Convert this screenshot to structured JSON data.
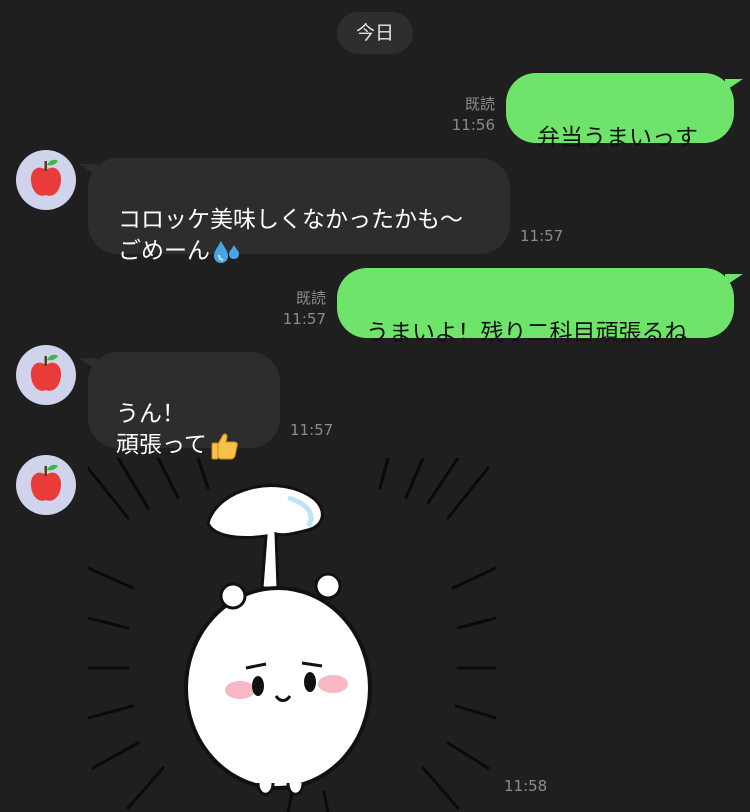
{
  "date_divider": "今日",
  "messages": [
    {
      "side": "out",
      "text": "弁当うまいっす",
      "read": "既読",
      "time": "11:56"
    },
    {
      "side": "in",
      "text": "コロッケ美味しくなかったかも〜\nごめーん",
      "emoji": "sweat-droplets-icon",
      "time": "11:57"
    },
    {
      "side": "out",
      "text": "うまいよ！残り二科目頑張るね",
      "read": "既読",
      "time": "11:57"
    },
    {
      "side": "in",
      "text": "うん！\n頑張って",
      "emoji": "thumbs-up-icon",
      "time": "11:57"
    },
    {
      "side": "in",
      "type": "sticker",
      "sticker": "white-creature-sticker",
      "time": "11:58"
    }
  ],
  "avatar": {
    "icon": "apple-icon",
    "bg": "#cfd4ec"
  },
  "colors": {
    "outgoing": "#6ee46b",
    "incoming": "#2d2d2d",
    "background": "#1f1f1f"
  }
}
